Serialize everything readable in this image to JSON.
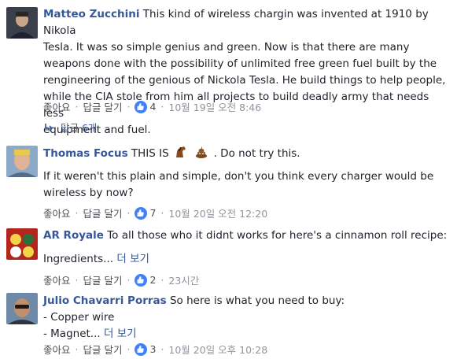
{
  "comments": [
    {
      "name": "Matteo Zucchini",
      "lines": [
        "This kind of wireless chargin was invented at 1910 by Nikola",
        "Tesla. It was so simple genius and green. Now is that there are many",
        "weapons done with the possibility of unlimited free green fuel built by the",
        "rengineering of the genious of Nickola Tesla. He build things to help people,",
        "while the CIA stole from him all projects to build deadly army that needs less",
        "equipment and fuel."
      ],
      "like_label": "좋아요",
      "reply_label": "답글 달기",
      "like_count": "4",
      "time": "10월 19일 오전 8:46",
      "replies_label": "답글 6개"
    },
    {
      "name": "Thomas Focus",
      "text_before": "THIS IS",
      "emoji": [
        "horse-icon",
        "poop-icon"
      ],
      "text_after": ". Do not try this.",
      "lines": [
        "If it weren't this plain and simple, don't you think every charger would be",
        "wireless by now?"
      ],
      "like_label": "좋아요",
      "reply_label": "답글 달기",
      "like_count": "7",
      "time": "10월 20일 오전 12:20"
    },
    {
      "name": "AR Royale",
      "text": "To all those who it didnt works for here's a cinnamon roll recipe:",
      "line2": "Ingredients...",
      "see_more": "더 보기",
      "like_label": "좋아요",
      "reply_label": "답글 달기",
      "like_count": "2",
      "time": "23시간"
    },
    {
      "name": "Julio Chavarri Porras",
      "text": "So here is what you need to buy:",
      "line2": "- Copper wire",
      "line3": "- Magnet...",
      "see_more": "더 보기",
      "like_label": "좋아요",
      "reply_label": "답글 달기",
      "like_count": "3",
      "time": "10월 20일 오후 10:28"
    }
  ],
  "colors": {
    "name": "#365899",
    "like": "#4080ff",
    "meta": "#4b4f56"
  }
}
